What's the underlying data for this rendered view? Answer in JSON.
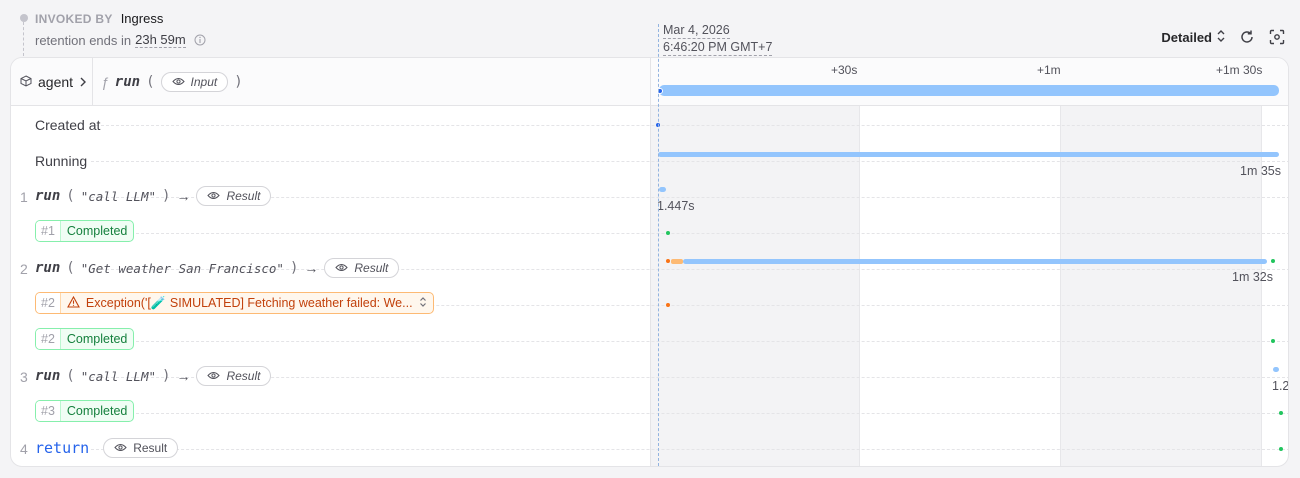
{
  "header": {
    "invoked_by_label": "INVOKED BY",
    "invoked_by_value": "Ingress",
    "retention_prefix": "retention ends in",
    "retention_value": "23h 59m"
  },
  "timeline": {
    "date": "Mar 4, 2026",
    "time": "6:46:20 PM GMT+7",
    "ticks": [
      "+30s",
      "+1m",
      "+1m 30s"
    ]
  },
  "controls": {
    "mode": "Detailed"
  },
  "service": {
    "name": "agent"
  },
  "root_call": {
    "fn": "run",
    "input_label": "Input"
  },
  "rows": {
    "created_at": "Created at",
    "running": "Running",
    "running_duration": "1m 35s"
  },
  "steps": [
    {
      "num": "1",
      "fn": "run",
      "arg": "\"call LLM\"",
      "result_label": "Result",
      "duration": "1.447s",
      "status_index": "#1",
      "status": "Completed"
    },
    {
      "num": "2",
      "fn": "run",
      "arg": "\"Get weather San Francisco\"",
      "result_label": "Result",
      "duration": "1m 32s",
      "error_index": "#2",
      "error_text": "Exception('[🧪 SIMULATED] Fetching weather failed: We...",
      "status_index": "#2",
      "status": "Completed"
    },
    {
      "num": "3",
      "fn": "run",
      "arg": "\"call LLM\"",
      "result_label": "Result",
      "duration": "1.2",
      "status_index": "#3",
      "status": "Completed"
    },
    {
      "num": "4",
      "fn": "return",
      "result_label": "Result"
    }
  ],
  "colors": {
    "bar": "#93c5fd",
    "completed": "#15803d",
    "error": "#c2410c",
    "dot_blue": "#2563eb",
    "dot_green": "#22c55e",
    "dot_orange": "#f97316"
  }
}
